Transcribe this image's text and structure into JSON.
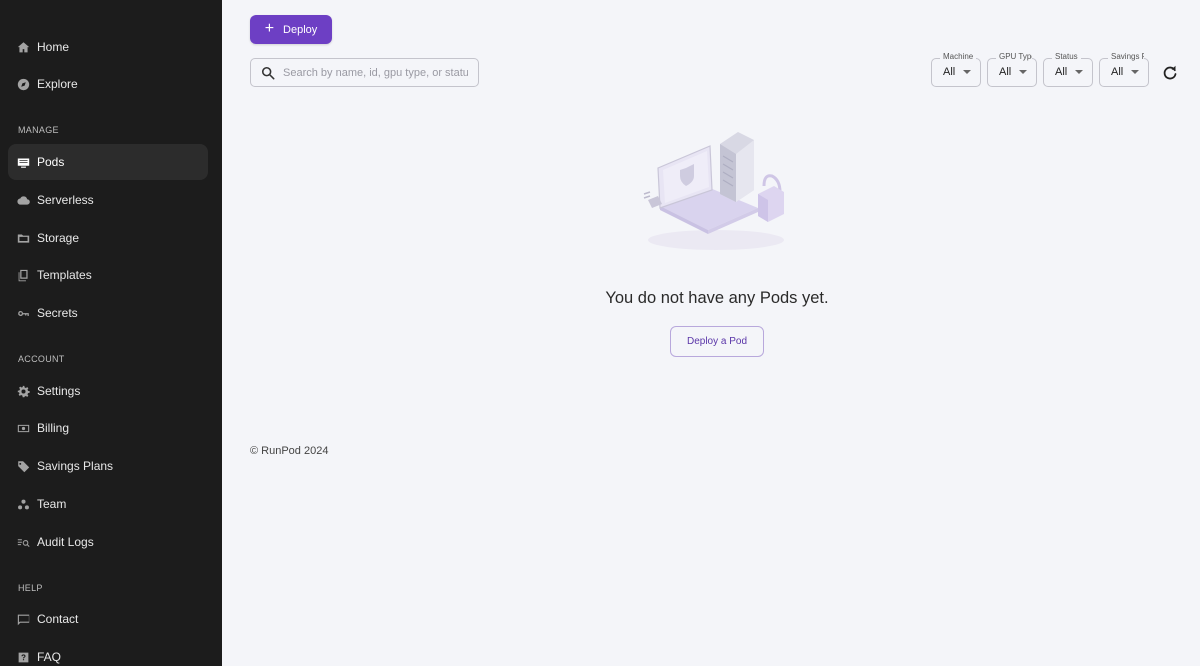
{
  "sidebar": {
    "items": [
      {
        "label": "Home",
        "icon": "home-icon"
      },
      {
        "label": "Explore",
        "icon": "compass-icon"
      },
      {
        "label": "Pods",
        "icon": "pods-icon",
        "active": true
      },
      {
        "label": "Serverless",
        "icon": "cloud-icon"
      },
      {
        "label": "Storage",
        "icon": "storage-icon"
      },
      {
        "label": "Templates",
        "icon": "templates-icon"
      },
      {
        "label": "Secrets",
        "icon": "key-icon"
      },
      {
        "label": "Settings",
        "icon": "gear-icon"
      },
      {
        "label": "Billing",
        "icon": "billing-icon"
      },
      {
        "label": "Savings Plans",
        "icon": "tag-icon"
      },
      {
        "label": "Team",
        "icon": "team-icon"
      },
      {
        "label": "Audit Logs",
        "icon": "audit-icon"
      },
      {
        "label": "Contact",
        "icon": "chat-icon"
      },
      {
        "label": "FAQ",
        "icon": "help-icon"
      }
    ],
    "sections": {
      "manage": "MANAGE",
      "account": "ACCOUNT",
      "help": "HELP"
    }
  },
  "toolbar": {
    "deploy_label": "Deploy",
    "search_placeholder": "Search by name, id, gpu type, or status"
  },
  "filters": [
    {
      "legend": "Machine",
      "value": "All"
    },
    {
      "legend": "GPU Type",
      "value": "All"
    },
    {
      "legend": "Status",
      "value": "All"
    },
    {
      "legend": "Savings Plan",
      "value": "All"
    }
  ],
  "empty_state": {
    "message": "You do not have any Pods yet.",
    "button_label": "Deploy a Pod"
  },
  "footer": {
    "copyright": "© RunPod 2024"
  },
  "colors": {
    "accent": "#6d3fc4",
    "sidebar_bg": "#1c1c1c",
    "page_bg": "#f4f5f9"
  }
}
